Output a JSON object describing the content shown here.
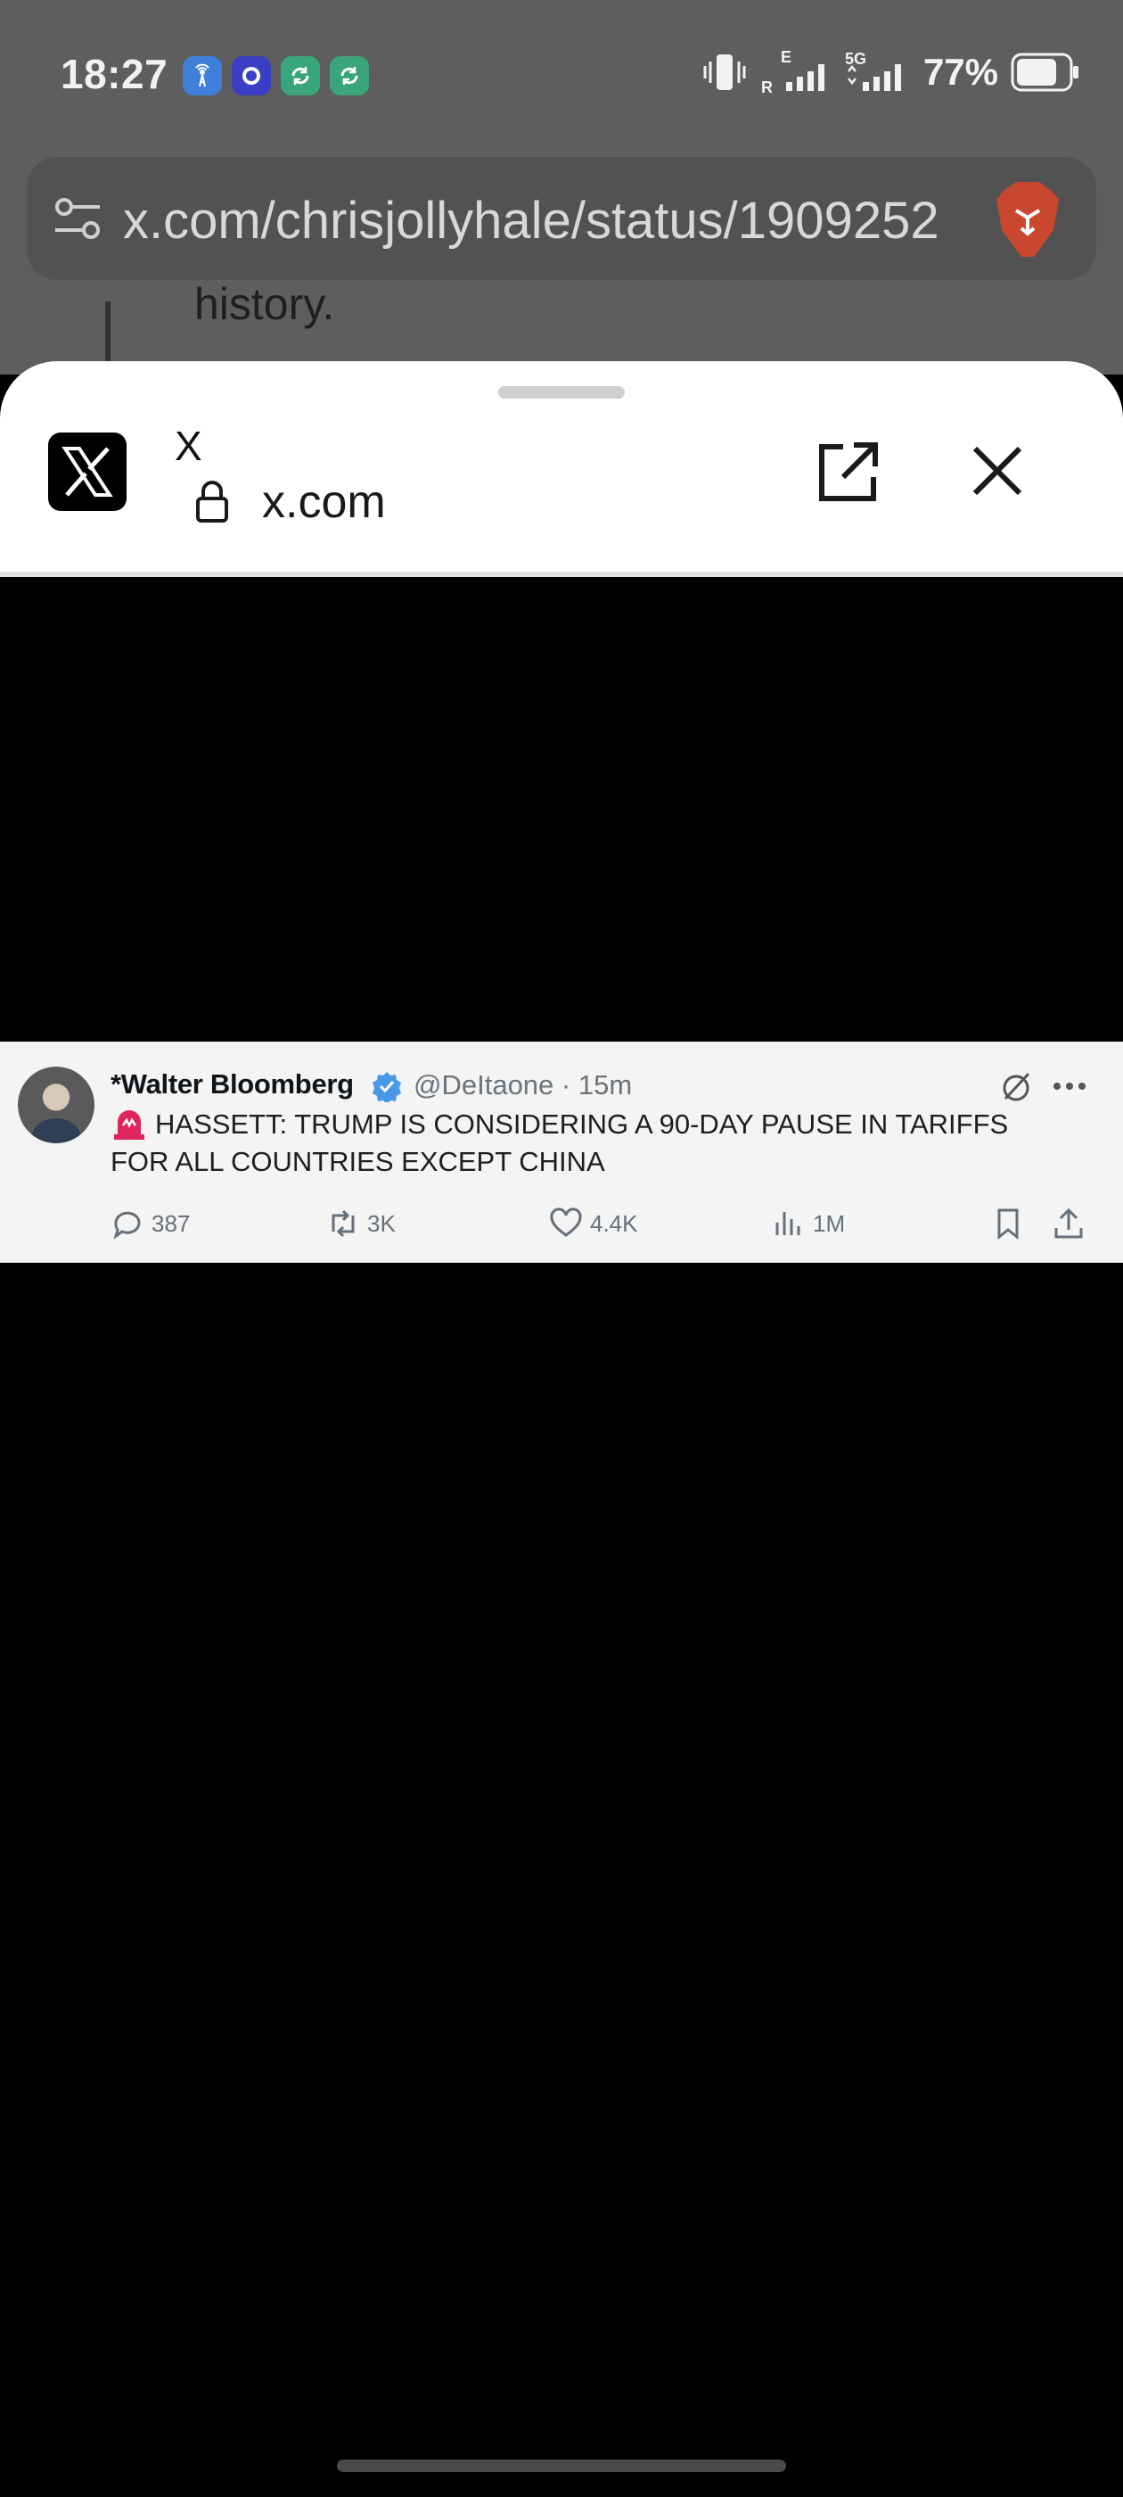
{
  "status_bar": {
    "time": "18:27",
    "battery": "77%",
    "network_5g": "5G",
    "network_e": "E",
    "network_r": "R"
  },
  "browser": {
    "url": "x.com/chrisjollyhale/status/1909252",
    "background_snippet": "history."
  },
  "custom_tab": {
    "title": "X",
    "domain": "x.com"
  },
  "tweet": {
    "author_name": "*Walter Bloomberg",
    "handle_time": "@DeItaone · 15m",
    "text": "HASSETT: TRUMP IS CONSIDERING A 90-DAY PAUSE IN TARIFFS FOR ALL COUNTRIES EXCEPT CHINA",
    "replies": "387",
    "reposts": "3K",
    "likes": "4.4K",
    "views": "1M"
  },
  "colors": {
    "verified": "#4a99e9",
    "siren": "#e0245e",
    "brave": "#c8472e",
    "notif_blue": "#3d7fd9",
    "notif_signal": "#3a76f0",
    "notif_green": "#3aa57a"
  }
}
